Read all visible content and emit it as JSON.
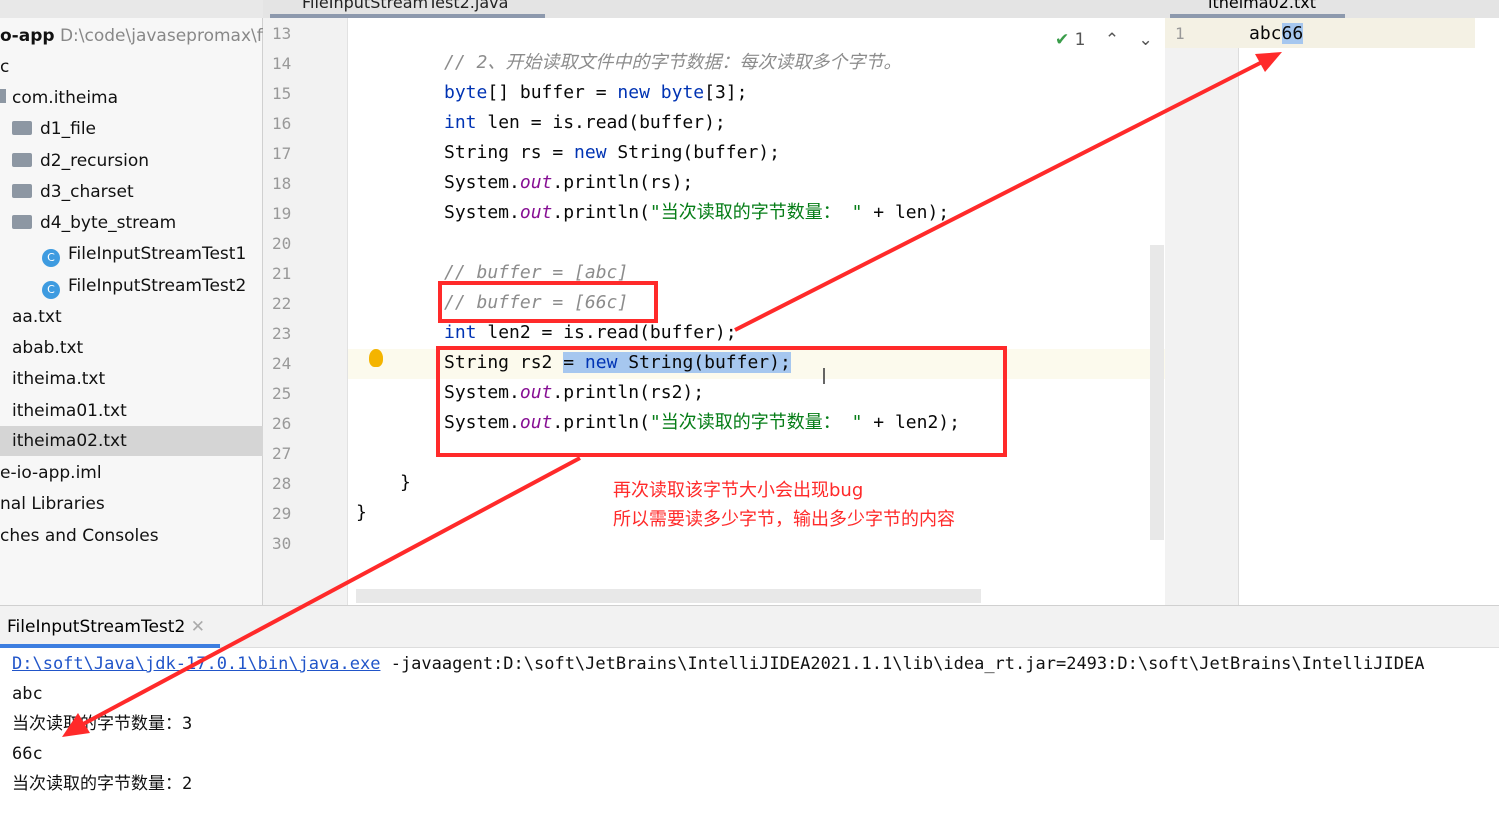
{
  "editor_tab": "FileInputStreamTest2.java",
  "file_tab": "itheima02.txt",
  "project": {
    "root_name": "o-app",
    "root_path": "D:\\code\\javasepromax\\file",
    "items": [
      "c",
      "com.itheima",
      "d1_file",
      "d2_recursion",
      "d3_charset",
      "d4_byte_stream",
      "FileInputStreamTest1",
      "FileInputStreamTest2",
      "aa.txt",
      "abab.txt",
      "itheima.txt",
      "itheima01.txt",
      "itheima02.txt",
      "e-io-app.iml",
      "nal Libraries",
      "ches and Consoles"
    ]
  },
  "line_numbers": [
    "13",
    "14",
    "15",
    "16",
    "17",
    "18",
    "19",
    "20",
    "21",
    "22",
    "23",
    "24",
    "25",
    "26",
    "27",
    "28",
    "29",
    "30"
  ],
  "inspection": {
    "count": "1"
  },
  "file_content": {
    "line": "1",
    "text_plain": "abc",
    "text_selected": "66"
  },
  "code": {
    "l14": "// 2、开始读取文件中的字节数据：每次读取多个字节。",
    "l21": "// buffer = [abc]",
    "l22": "// buffer = [66c]"
  },
  "annotation": {
    "line1": "再次读取该字节大小会出现bug",
    "line2": "所以需要读多少字节，输出多少字节的内容",
    "color": "#ff2a2a"
  },
  "run": {
    "tab": "FileInputStreamTest2",
    "cmd_link": "D:\\soft\\Java\\jdk-17.0.1\\bin\\java.exe",
    "cmd_rest": " -javaagent:D:\\soft\\JetBrains\\IntelliJIDEA2021.1.1\\lib\\idea_rt.jar=2493:D:\\soft\\JetBrains\\IntelliJIDEA",
    "out": [
      "abc",
      "当次读取的字节数量：3",
      "66c",
      "当次读取的字节数量：2"
    ]
  }
}
